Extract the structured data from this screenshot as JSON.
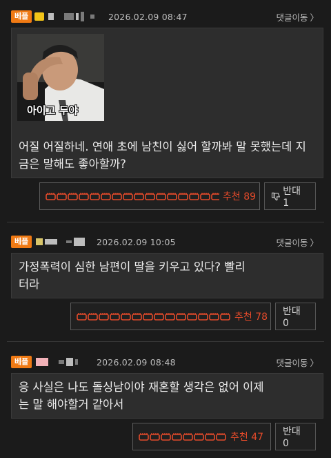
{
  "comments": [
    {
      "badge": "베플",
      "date": "2026.02.09 08:47",
      "goto_label": "댓글이동",
      "image_caption": "아이고 두야",
      "text": "어질 어질하네. 연애 초에 남친이 싫어 할까봐 말 못했는데  지금은 말해도 좋아할까?",
      "recommend_label": "추천",
      "recommend_count": "89",
      "oppose_label": "반대",
      "oppose_count": "1"
    },
    {
      "badge": "베플",
      "date": "2026.02.09 10:05",
      "goto_label": "댓글이동",
      "text": "가정폭력이 심한 남편이 딸을 키우고 있다? 빨리 터라",
      "recommend_label": "추천",
      "recommend_count": "78",
      "oppose_label": "반대",
      "oppose_count": "0"
    },
    {
      "badge": "베플",
      "date": "2026.02.09 08:48",
      "goto_label": "댓글이동",
      "text": "응 사실은 나도 돌싱남이야 재혼할 생각은 없어 이제는 말 해야할거 같아서",
      "recommend_label": "추천",
      "recommend_count": "47",
      "oppose_label": "반대",
      "oppose_count": "0"
    }
  ],
  "icons": {
    "goto": "chevron-right-icon",
    "recommend": "fist-icon",
    "oppose": "thumbs-down-icon"
  },
  "colors": {
    "badge": "#f07a14",
    "recommend": "#e34a2a",
    "background": "#1b1b1b",
    "box": "#2d2d2d"
  }
}
